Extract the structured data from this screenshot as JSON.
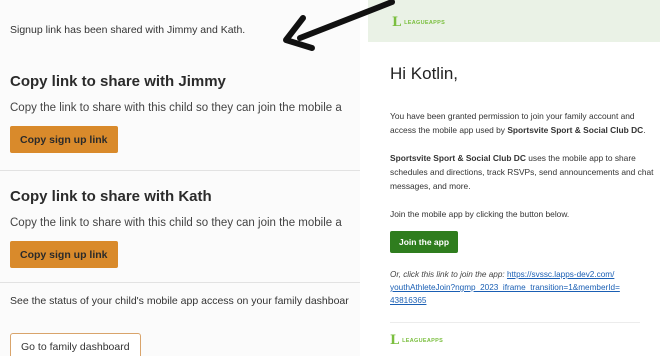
{
  "left_panel": {
    "top_note": "Signup link has been shared with Jimmy and Kath.",
    "sections": [
      {
        "title": "Copy link to share with Jimmy",
        "description": "Copy the link to share with this child so they can join the mobile a",
        "button_label": "Copy sign up link"
      },
      {
        "title": "Copy link to share with Kath",
        "description": "Copy the link to share with this child so they can join the mobile a",
        "button_label": "Copy sign up link"
      }
    ],
    "status_note": "See the status of your child's mobile app access on your family dashboar",
    "dashboard_button": "Go to family dashboard"
  },
  "email": {
    "logo_text": "LEAGUEAPPS",
    "logo_mark": "L",
    "greeting": "Hi Kotlin,",
    "para1_line1": "You have been granted permission to join your family account and",
    "para1_line2_pre": "access the mobile app used by ",
    "para1_line2_org": "Sportsvite Sport & Social Club DC",
    "para1_line2_post": ".",
    "para2_org": "Sportsvite Sport & Social Club DC",
    "para2_line1_post": " uses the mobile app to share",
    "para2_line2": "schedules and directions, track RSVPs, send announcements and chat",
    "para2_line3": "messages, and more.",
    "join_instruction": "Join the mobile app by clicking the button below.",
    "join_button": "Join the app",
    "alt_text": "Or, click this link to join the app:",
    "link_line1": "https://svssc.lapps-dev2.com/",
    "link_line2": "youthAthleteJoin?ngmp_2023_iframe_transition=1&memberId=",
    "link_line3": "43816365",
    "footer_logo_text": "LEAGUEAPPS"
  },
  "colors": {
    "orange_button": "#d98a2b",
    "green_button": "#2f7d1e",
    "brand_green": "#7bbf3f",
    "link_blue": "#1a5fb4",
    "arrow": "#111111"
  }
}
